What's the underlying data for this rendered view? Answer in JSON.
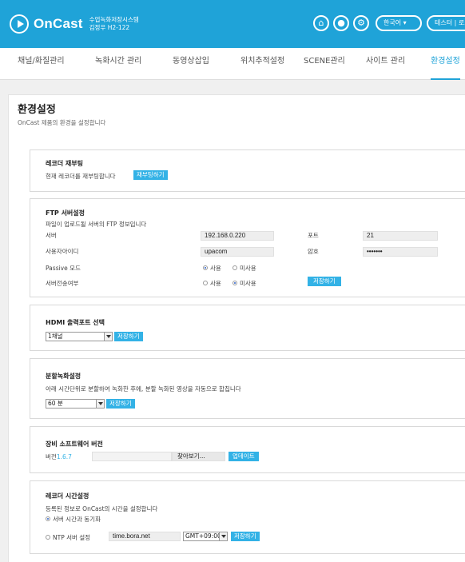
{
  "brand": {
    "name": "OnCast",
    "sub1": "수업녹화저장시스템",
    "sub2": "김정우 H2-122"
  },
  "top": {
    "language": "한국어",
    "user": "테스터 | 로그아웃"
  },
  "nav": [
    "채널/화질관리",
    "녹화시간 관리",
    "동영상삽입",
    "위치추적설정",
    "SCENE관리",
    "사이트 관리",
    "환경설정"
  ],
  "page": {
    "title": "환경설정",
    "desc": "OnCast 제품의 환경을 설정합니다"
  },
  "reboot": {
    "title": "레코더 재부팅",
    "desc": "현재 레코더를 재부팅합니다",
    "button": "재부팅하기"
  },
  "ftp": {
    "title": "FTP 서버설정",
    "desc": "파일이 업로드될 서버의 FTP 정보입니다",
    "server_label": "서버",
    "server_value": "192.168.0.220",
    "port_label": "포트",
    "port_value": "21",
    "user_label": "사용자아이디",
    "user_value": "upacom",
    "pw_label": "암호",
    "pw_value": "•••••••",
    "passive_label": "Passive 모드",
    "use": "사용",
    "nouse": "미사용",
    "transfer_label": "서버전송여부",
    "save": "저장하기"
  },
  "hdmi": {
    "title": "HDMI 출력포트 선택",
    "selected": "1채널",
    "save": "저장하기"
  },
  "split": {
    "title": "분할녹화설정",
    "desc": "아래 시간단위로 분할하여 녹화한 후에, 분할 녹화된 영상을 자동으로 합칩니다",
    "selected": "60 분",
    "save": "저장하기"
  },
  "firmware": {
    "title": "장비 소프트웨어 버전",
    "version_label": "버전",
    "version": "1.6.7",
    "browse": "찾아보기...",
    "update": "업데이트"
  },
  "time": {
    "title": "레코더 시간설정",
    "desc": "등록된 정보로 OnCast의 시간을 설정합니다",
    "sync_label": "서버 시간과 동기화",
    "ntp_label": "NTP 서버 설정",
    "ntp_value": "time.bora.net",
    "tz": "GMT+09:00",
    "save": "저장하기"
  }
}
